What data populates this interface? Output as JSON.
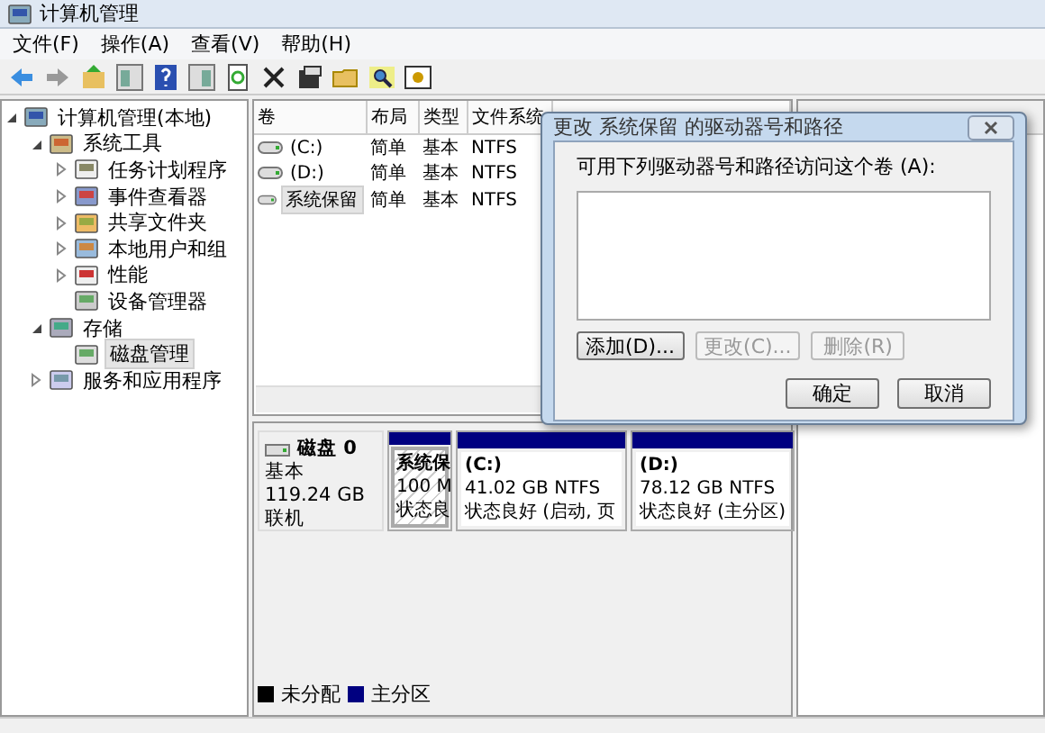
{
  "window": {
    "title": "计算机管理"
  },
  "menu": [
    "文件(F)",
    "操作(A)",
    "查看(V)",
    "帮助(H)"
  ],
  "tree": [
    {
      "label": "计算机管理(本地)",
      "expanded": true,
      "selected": false,
      "children": [
        {
          "label": "系统工具",
          "expanded": true,
          "selected": false,
          "children": [
            {
              "label": "任务计划程序",
              "expanded": false,
              "selected": false
            },
            {
              "label": "事件查看器",
              "expanded": false,
              "selected": false
            },
            {
              "label": "共享文件夹",
              "expanded": false,
              "selected": false
            },
            {
              "label": "本地用户和组",
              "expanded": false,
              "selected": false
            },
            {
              "label": "性能",
              "expanded": false,
              "selected": false
            },
            {
              "label": "设备管理器",
              "selected": false
            }
          ]
        },
        {
          "label": "存储",
          "expanded": true,
          "selected": false,
          "children": [
            {
              "label": "磁盘管理",
              "selected": true
            }
          ]
        },
        {
          "label": "服务和应用程序",
          "expanded": false,
          "selected": false
        }
      ]
    }
  ],
  "volume_table": {
    "columns": [
      "卷",
      "布局",
      "类型",
      "文件系统"
    ],
    "rows": [
      {
        "cells": [
          "(C:)",
          "简单",
          "基本",
          "NTFS"
        ],
        "selected": false
      },
      {
        "cells": [
          "(D:)",
          "简单",
          "基本",
          "NTFS"
        ],
        "selected": false
      },
      {
        "cells": [
          "系统保留",
          "简单",
          "基本",
          "NTFS"
        ],
        "selected": true
      }
    ]
  },
  "disk": {
    "name": "磁盘 0",
    "type": "基本",
    "size": "119.24 GB",
    "status": "联机",
    "partitions": [
      {
        "name": "系统保",
        "size": "100 M",
        "status": "状态良",
        "selected": true
      },
      {
        "name": "(C:)",
        "size": "41.02 GB NTFS",
        "status": "状态良好 (启动, 页",
        "selected": false
      },
      {
        "name": "(D:)",
        "size": "78.12 GB NTFS",
        "status": "状态良好 (主分区)",
        "selected": false
      }
    ]
  },
  "legend": [
    {
      "label": "未分配",
      "color": "#000000"
    },
    {
      "label": "主分区",
      "color": "#000080"
    }
  ],
  "dialog": {
    "title": "更改 系统保留 的驱动器号和路径",
    "prompt": "可用下列驱动器号和路径访问这个卷 (A):",
    "actions": [
      {
        "label": "添加(D)...",
        "disabled": false
      },
      {
        "label": "更改(C)...",
        "disabled": true
      },
      {
        "label": "删除(R)",
        "disabled": true
      }
    ],
    "buttons": [
      "确定",
      "取消"
    ]
  }
}
